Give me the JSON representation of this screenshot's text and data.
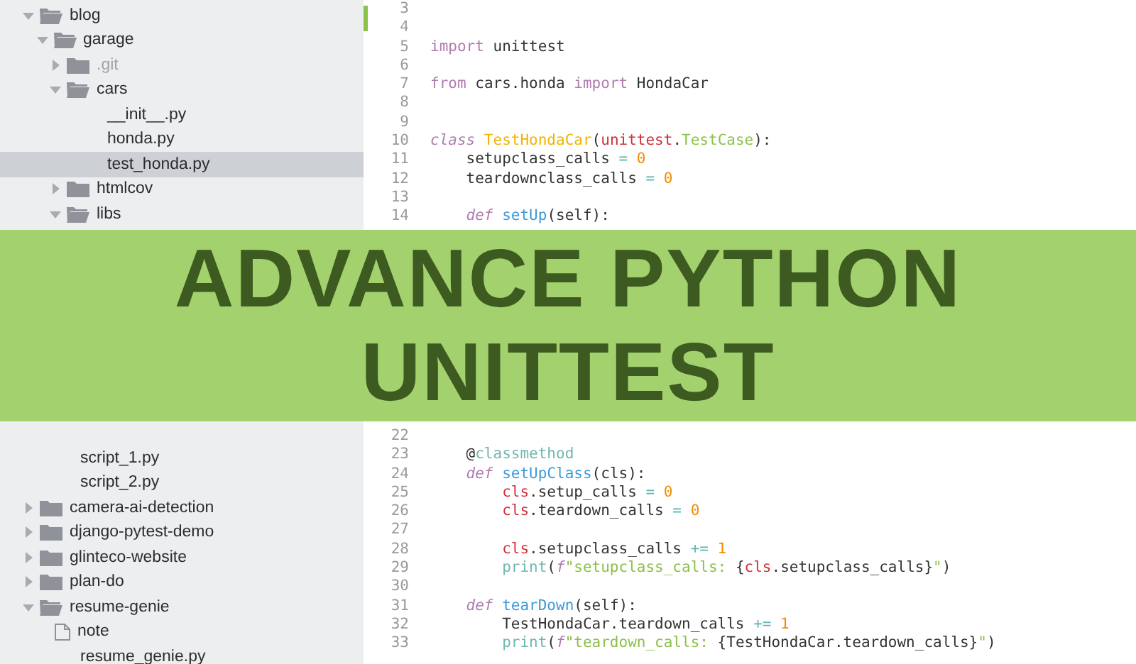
{
  "sidebar_upper": [
    {
      "name": "blog",
      "kind": "folder",
      "expanded": true,
      "selected": false,
      "ignored": false,
      "children": [
        {
          "name": "garage",
          "kind": "folder",
          "expanded": true,
          "selected": false,
          "ignored": false,
          "children": [
            {
              "name": ".git",
              "kind": "folder",
              "expanded": false,
              "selected": false,
              "ignored": true
            },
            {
              "name": "cars",
              "kind": "folder",
              "expanded": true,
              "selected": false,
              "ignored": false,
              "children": [
                {
                  "name": "__init__.py",
                  "kind": "file",
                  "selected": false,
                  "ignored": false
                },
                {
                  "name": "honda.py",
                  "kind": "file",
                  "selected": false,
                  "ignored": false
                },
                {
                  "name": "test_honda.py",
                  "kind": "file",
                  "selected": true,
                  "ignored": false
                }
              ]
            },
            {
              "name": "htmlcov",
              "kind": "folder",
              "expanded": false,
              "selected": false,
              "ignored": false
            },
            {
              "name": "libs",
              "kind": "folder",
              "expanded": true,
              "selected": false,
              "ignored": false
            }
          ]
        }
      ]
    }
  ],
  "sidebar_lower": [
    {
      "kind": "continuation",
      "children": [
        {
          "name": "script_1.py",
          "kind": "file",
          "selected": false,
          "ignored": false
        },
        {
          "name": "script_2.py",
          "kind": "file",
          "selected": false,
          "ignored": false
        }
      ]
    },
    {
      "name": "camera-ai-detection",
      "kind": "folder",
      "expanded": false,
      "selected": false,
      "ignored": false
    },
    {
      "name": "django-pytest-demo",
      "kind": "folder",
      "expanded": false,
      "selected": false,
      "ignored": false
    },
    {
      "name": "glinteco-website",
      "kind": "folder",
      "expanded": false,
      "selected": false,
      "ignored": false
    },
    {
      "name": "plan-do",
      "kind": "folder",
      "expanded": false,
      "selected": false,
      "ignored": false
    },
    {
      "name": "resume-genie",
      "kind": "folder",
      "expanded": true,
      "selected": false,
      "ignored": false,
      "children": [
        {
          "name": "note",
          "kind": "note",
          "selected": false,
          "ignored": false
        },
        {
          "name": "resume_genie.py",
          "kind": "file",
          "selected": false,
          "ignored": false
        }
      ]
    }
  ],
  "code_upper": [
    {
      "number": "3"
    },
    {
      "number": "4"
    },
    {
      "number": "5",
      "tokens": [
        {
          "kind": "keyword",
          "text": "import"
        },
        {
          "kind": "plain",
          "text": " unittest"
        }
      ]
    },
    {
      "number": "6"
    },
    {
      "number": "7",
      "tokens": [
        {
          "kind": "keyword",
          "text": "from"
        },
        {
          "kind": "plain",
          "text": " cars.honda "
        },
        {
          "kind": "keyword",
          "text": "import"
        },
        {
          "kind": "plain",
          "text": " HondaCar"
        }
      ]
    },
    {
      "number": "8"
    },
    {
      "number": "9"
    },
    {
      "number": "10",
      "tokens": [
        {
          "kind": "storage",
          "text": "class"
        },
        {
          "kind": "classname",
          "text": " TestHondaCar"
        },
        {
          "kind": "plain",
          "text": "("
        },
        {
          "kind": "support",
          "text": "unittest"
        },
        {
          "kind": "plain",
          "text": "."
        },
        {
          "kind": "inherited",
          "text": "TestCase"
        },
        {
          "kind": "plain",
          "text": "):"
        }
      ],
      "children": [
        {
          "number": "11",
          "tokens": [
            {
              "kind": "plain",
              "text": "setupclass_calls"
            },
            {
              "kind": "operator",
              "text": " ="
            },
            {
              "kind": "number",
              "text": " 0"
            }
          ]
        },
        {
          "number": "12",
          "tokens": [
            {
              "kind": "plain",
              "text": "teardownclass_calls"
            },
            {
              "kind": "operator",
              "text": " ="
            },
            {
              "kind": "number",
              "text": " 0"
            }
          ]
        },
        {
          "number": "13"
        },
        {
          "number": "14",
          "tokens": [
            {
              "kind": "storage",
              "text": "def"
            },
            {
              "kind": "function",
              "text": " setUp"
            },
            {
              "kind": "plain",
              "text": "(self):"
            }
          ]
        }
      ]
    }
  ],
  "banner": {
    "lines": [
      "ADVANCE PYTHON",
      "UNITTEST"
    ]
  },
  "code_lower": [
    {
      "kind": "continuation",
      "children": [
        {
          "number": "22"
        },
        {
          "number": "23",
          "tokens": [
            {
              "kind": "plain",
              "text": "@"
            },
            {
              "kind": "decorator",
              "text": "classmethod"
            }
          ]
        },
        {
          "number": "24",
          "tokens": [
            {
              "kind": "storage",
              "text": "def"
            },
            {
              "kind": "function",
              "text": " setUpClass"
            },
            {
              "kind": "plain",
              "text": "(cls):"
            }
          ],
          "children": [
            {
              "number": "25",
              "tokens": [
                {
                  "kind": "support",
                  "text": "cls"
                },
                {
                  "kind": "plain",
                  "text": ".setup_calls"
                },
                {
                  "kind": "operator",
                  "text": " ="
                },
                {
                  "kind": "number",
                  "text": " 0"
                }
              ]
            },
            {
              "number": "26",
              "tokens": [
                {
                  "kind": "support",
                  "text": "cls"
                },
                {
                  "kind": "plain",
                  "text": ".teardown_calls"
                },
                {
                  "kind": "operator",
                  "text": " ="
                },
                {
                  "kind": "number",
                  "text": " 0"
                }
              ]
            },
            {
              "number": "27"
            },
            {
              "number": "28",
              "tokens": [
                {
                  "kind": "support",
                  "text": "cls"
                },
                {
                  "kind": "plain",
                  "text": ".setupclass_calls"
                },
                {
                  "kind": "operator",
                  "text": " +="
                },
                {
                  "kind": "number",
                  "text": " 1"
                }
              ]
            },
            {
              "number": "29",
              "tokens": [
                {
                  "kind": "builtin",
                  "text": "print"
                },
                {
                  "kind": "plain",
                  "text": "("
                },
                {
                  "kind": "storage",
                  "text": "f"
                },
                {
                  "kind": "string",
                  "text": "\"setupclass_calls:"
                },
                {
                  "kind": "plain",
                  "text": " {"
                },
                {
                  "kind": "support",
                  "text": "cls"
                },
                {
                  "kind": "plain",
                  "text": ".setupclass_calls}"
                },
                {
                  "kind": "string",
                  "text": "\""
                },
                {
                  "kind": "plain",
                  "text": ")"
                }
              ]
            }
          ]
        },
        {
          "number": "30"
        },
        {
          "number": "31",
          "tokens": [
            {
              "kind": "storage",
              "text": "def"
            },
            {
              "kind": "function",
              "text": " tearDown"
            },
            {
              "kind": "plain",
              "text": "(self):"
            }
          ],
          "children": [
            {
              "number": "32",
              "tokens": [
                {
                  "kind": "plain",
                  "text": "TestHondaCar.teardown_calls"
                },
                {
                  "kind": "operator",
                  "text": " +="
                },
                {
                  "kind": "number",
                  "text": " 1"
                }
              ]
            },
            {
              "number": "33",
              "tokens": [
                {
                  "kind": "builtin",
                  "text": "print"
                },
                {
                  "kind": "plain",
                  "text": "("
                },
                {
                  "kind": "storage",
                  "text": "f"
                },
                {
                  "kind": "string",
                  "text": "\"teardown_calls:"
                },
                {
                  "kind": "plain",
                  "text": " {TestHondaCar.teardown_calls}"
                },
                {
                  "kind": "string",
                  "text": "\""
                },
                {
                  "kind": "plain",
                  "text": ")"
                }
              ]
            }
          ]
        }
      ]
    }
  ]
}
